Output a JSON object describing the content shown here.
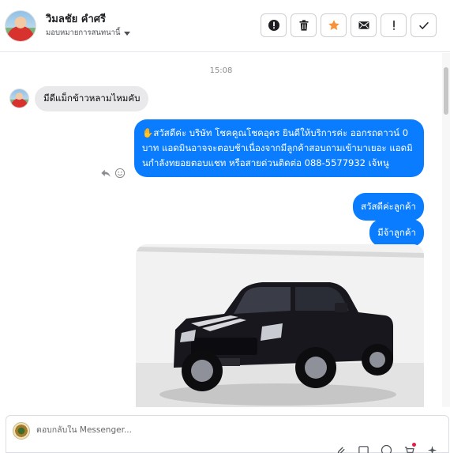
{
  "header": {
    "contact_name": "วิมลชัย คำศรี",
    "assign_label": "มอบหมายการสนทนานี้",
    "actions": [
      {
        "name": "report-spam",
        "icon": "alert-circle-icon"
      },
      {
        "name": "delete",
        "icon": "trash-icon"
      },
      {
        "name": "star",
        "icon": "star-icon",
        "color": "#f7923a"
      },
      {
        "name": "mark-unread",
        "icon": "envelope-icon"
      },
      {
        "name": "follow-up",
        "icon": "exclamation-icon"
      },
      {
        "name": "mark-done",
        "icon": "check-icon"
      }
    ]
  },
  "thread": {
    "timestamp": "15:08",
    "incoming": [
      {
        "text": "มีดีแม็กข้าวหลามไหมคับ"
      }
    ],
    "outgoing": [
      {
        "text": "✋สวัสดีค่ะ บริษัท โชคคูณโชคอุดร ยินดีให้บริการค่ะ ออกรถดาวน์ 0 บาท แอดมินอาจจะตอบช้าเนื่องจากมีลูกค้าสอบถามเข้ามาเยอะ แอดมินกำลังทยอยตอบแชท หรือสายด่วนติดต่อ 088-5577932 เจ้หนู"
      },
      {
        "text": "สวัสดีค่ะลูกค้า"
      },
      {
        "text": "มีจ้าลูกค้า"
      }
    ],
    "attachment": {
      "type": "photo",
      "subject": "black pickup truck"
    }
  },
  "composer": {
    "placeholder": "ตอบกลับใน Messenger..."
  },
  "colors": {
    "outgoing_bubble": "#0a7cff",
    "incoming_bubble": "#e9e9eb",
    "star_accent": "#f7923a"
  }
}
